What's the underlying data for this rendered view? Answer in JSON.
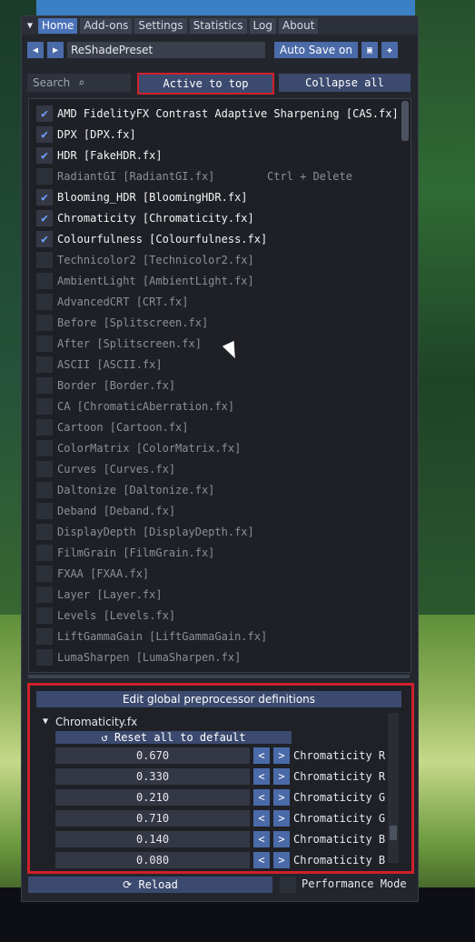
{
  "menu": {
    "tabs": [
      "Home",
      "Add-ons",
      "Settings",
      "Statistics",
      "Log",
      "About"
    ],
    "active_tab": "Home"
  },
  "toolbar": {
    "prev_icon": "left-arrow-icon",
    "next_icon": "right-arrow-icon",
    "preset_name": "ReShadePreset",
    "auto_save_label": "Auto Save on",
    "save_icon": "floppy-disk-icon",
    "add_icon": "plus-icon"
  },
  "search": {
    "placeholder": "Search",
    "icon": "magnifier-icon"
  },
  "buttons": {
    "active_to_top": "Active to top",
    "collapse_all": "Collapse all",
    "edit_global": "Edit global preprocessor definitions",
    "reset_all": "Reset all to default",
    "reload": "Reload"
  },
  "effects": [
    {
      "label": "AMD FidelityFX Contrast Adaptive Sharpening [CAS.fx]",
      "enabled": true
    },
    {
      "label": "DPX [DPX.fx]",
      "enabled": true
    },
    {
      "label": "HDR [FakeHDR.fx]",
      "enabled": true
    },
    {
      "label": "RadiantGI [RadiantGI.fx]",
      "enabled": false,
      "hint": "Ctrl + Delete"
    },
    {
      "label": "Blooming_HDR [BloomingHDR.fx]",
      "enabled": true
    },
    {
      "label": "Chromaticity [Chromaticity.fx]",
      "enabled": true
    },
    {
      "label": "Colourfulness [Colourfulness.fx]",
      "enabled": true
    },
    {
      "label": "Technicolor2 [Technicolor2.fx]",
      "enabled": false
    },
    {
      "label": "AmbientLight [AmbientLight.fx]",
      "enabled": false
    },
    {
      "label": "AdvancedCRT [CRT.fx]",
      "enabled": false
    },
    {
      "label": "Before [Splitscreen.fx]",
      "enabled": false
    },
    {
      "label": "After [Splitscreen.fx]",
      "enabled": false
    },
    {
      "label": "ASCII [ASCII.fx]",
      "enabled": false
    },
    {
      "label": "Border [Border.fx]",
      "enabled": false
    },
    {
      "label": "CA [ChromaticAberration.fx]",
      "enabled": false
    },
    {
      "label": "Cartoon [Cartoon.fx]",
      "enabled": false
    },
    {
      "label": "ColorMatrix [ColorMatrix.fx]",
      "enabled": false
    },
    {
      "label": "Curves [Curves.fx]",
      "enabled": false
    },
    {
      "label": "Daltonize [Daltonize.fx]",
      "enabled": false
    },
    {
      "label": "Deband [Deband.fx]",
      "enabled": false
    },
    {
      "label": "DisplayDepth [DisplayDepth.fx]",
      "enabled": false
    },
    {
      "label": "FilmGrain [FilmGrain.fx]",
      "enabled": false
    },
    {
      "label": "FXAA [FXAA.fx]",
      "enabled": false
    },
    {
      "label": "Layer [Layer.fx]",
      "enabled": false
    },
    {
      "label": "Levels [Levels.fx]",
      "enabled": false
    },
    {
      "label": "LiftGammaGain [LiftGammaGain.fx]",
      "enabled": false
    },
    {
      "label": "LumaSharpen [LumaSharpen.fx]",
      "enabled": false
    }
  ],
  "settings_panel": {
    "title": "Chromaticity.fx",
    "params": [
      {
        "value": "0.670",
        "label": "Chromaticity R"
      },
      {
        "value": "0.330",
        "label": "Chromaticity R"
      },
      {
        "value": "0.210",
        "label": "Chromaticity G"
      },
      {
        "value": "0.710",
        "label": "Chromaticity G"
      },
      {
        "value": "0.140",
        "label": "Chromaticity B"
      },
      {
        "value": "0.080",
        "label": "Chromaticity B"
      }
    ]
  },
  "footer": {
    "performance_mode_label": "Performance Mode",
    "performance_mode": false
  },
  "colors": {
    "accent": "#4a72b8",
    "highlight_border": "#d0202a",
    "check": "#6fa0ff"
  }
}
